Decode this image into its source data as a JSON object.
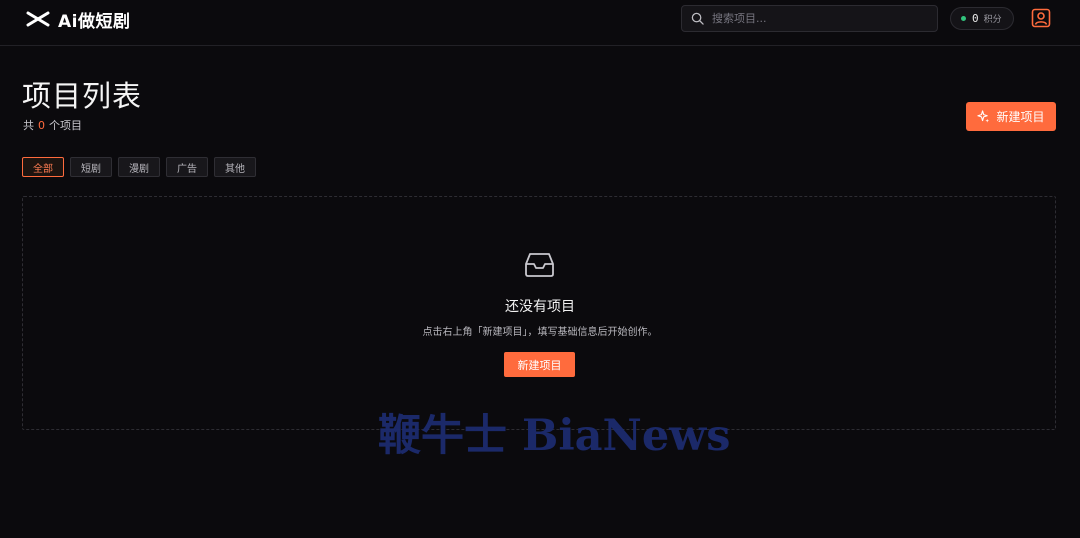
{
  "app": {
    "name": "Ai做短剧"
  },
  "header": {
    "search_placeholder": "搜索项目...",
    "points_value": "0",
    "points_label": "积分"
  },
  "page": {
    "title": "项目列表",
    "count_prefix": "共",
    "count_value": "0",
    "count_suffix": "个项目",
    "new_project_label": "新建项目"
  },
  "tabs": [
    {
      "label": "全部",
      "active": true
    },
    {
      "label": "短剧",
      "active": false
    },
    {
      "label": "漫剧",
      "active": false
    },
    {
      "label": "广告",
      "active": false
    },
    {
      "label": "其他",
      "active": false
    }
  ],
  "empty": {
    "title": "还没有项目",
    "description": "点击右上角「新建项目」，填写基础信息后开始创作。",
    "button_label": "新建项目"
  },
  "watermark": "鞭牛士 BiaNews",
  "colors": {
    "accent": "#ff6b3d",
    "status_dot": "#31c27c",
    "background": "#0b0a0d"
  },
  "icons": [
    "logo-icon",
    "search-icon",
    "user-icon",
    "sparkle-icon",
    "inbox-icon"
  ]
}
